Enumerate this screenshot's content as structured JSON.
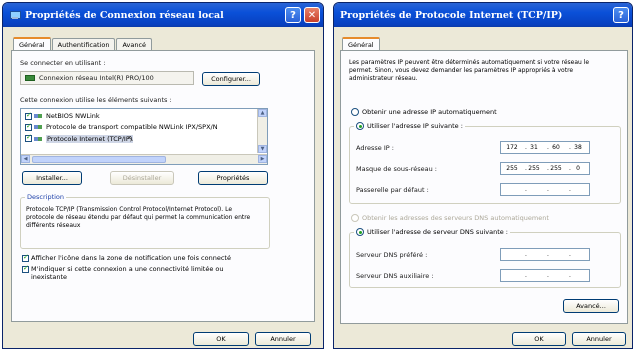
{
  "left": {
    "title": "Propriétés de Connexion réseau local",
    "tabs": [
      "Général",
      "Authentification",
      "Avancé"
    ],
    "connect_using_label": "Se connecter en utilisant :",
    "adapter": "Connexion réseau Intel(R) PRO/100",
    "configure_btn": "Configurer...",
    "components_label": "Cette connexion utilise les éléments suivants :",
    "components": [
      {
        "checked": true,
        "label": "NetBIOS NWLink"
      },
      {
        "checked": true,
        "label": "Protocole de transport compatible NWLink IPX/SPX/N"
      },
      {
        "checked": true,
        "label": "Protocole Internet (TCP/IP)"
      }
    ],
    "install_btn": "Installer...",
    "uninstall_btn": "Désinstaller",
    "properties_btn": "Propriétés",
    "description_label": "Description",
    "description_text": "Protocole TCP/IP (Transmission Control Protocol/Internet Protocol). Le protocole de réseau étendu par défaut qui permet la communication entre différents réseaux",
    "option1": "Afficher l'icône dans la zone de notification une fois connecté",
    "option2": "M'indiquer si cette connexion a une connectivité limitée ou inexistante",
    "ok_btn": "OK",
    "cancel_btn": "Annuler"
  },
  "right": {
    "title": "Propriétés de Protocole Internet (TCP/IP)",
    "tab": "Général",
    "intro": "Les paramètres IP peuvent être déterminés automatiquement si votre réseau le permet. Sinon, vous devez demander les paramètres IP appropriés à votre administrateur réseau.",
    "radio_auto_ip": "Obtenir une adresse IP automatiquement",
    "radio_manual_ip": "Utiliser l'adresse IP suivante :",
    "ip_label": "Adresse IP :",
    "ip_value": [
      "172",
      "31",
      "60",
      "38"
    ],
    "mask_label": "Masque de sous-réseau :",
    "mask_value": [
      "255",
      "255",
      "255",
      "0"
    ],
    "gateway_label": "Passerelle par défaut :",
    "radio_auto_dns": "Obtenir les adresses des serveurs DNS automatiquement",
    "radio_manual_dns": "Utiliser l'adresse de serveur DNS suivante :",
    "dns_pref_label": "Serveur DNS préféré :",
    "dns_alt_label": "Serveur DNS auxiliaire :",
    "advanced_btn": "Avancé...",
    "ok_btn": "OK",
    "cancel_btn": "Annuler"
  }
}
